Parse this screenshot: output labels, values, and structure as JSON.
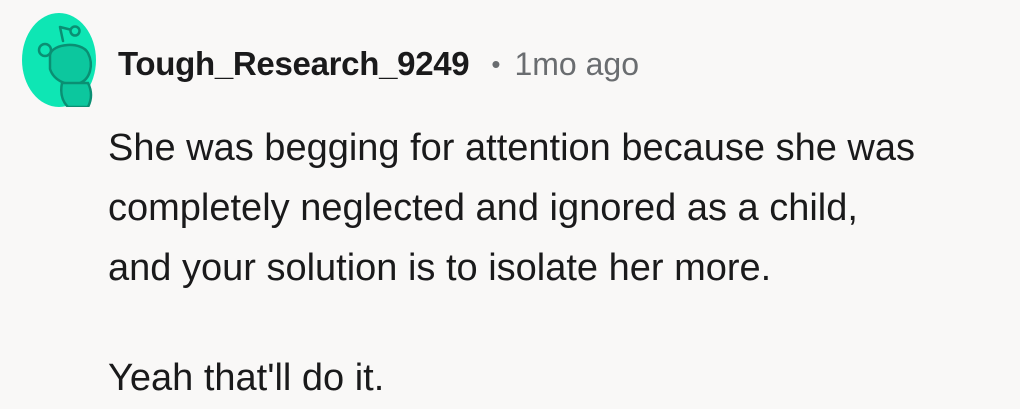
{
  "comment": {
    "author": "Tough_Research_9249",
    "separator": "•",
    "timestamp": "1mo ago",
    "avatar_icon": "reddit-snoo-avatar-icon",
    "avatar_color": "#0ee6b4",
    "body_lines": [
      "She was begging for attention because she was",
      "completely neglected and ignored as a child,",
      "and your solution is to isolate her more."
    ],
    "second_paragraph": "Yeah that'll do it."
  }
}
